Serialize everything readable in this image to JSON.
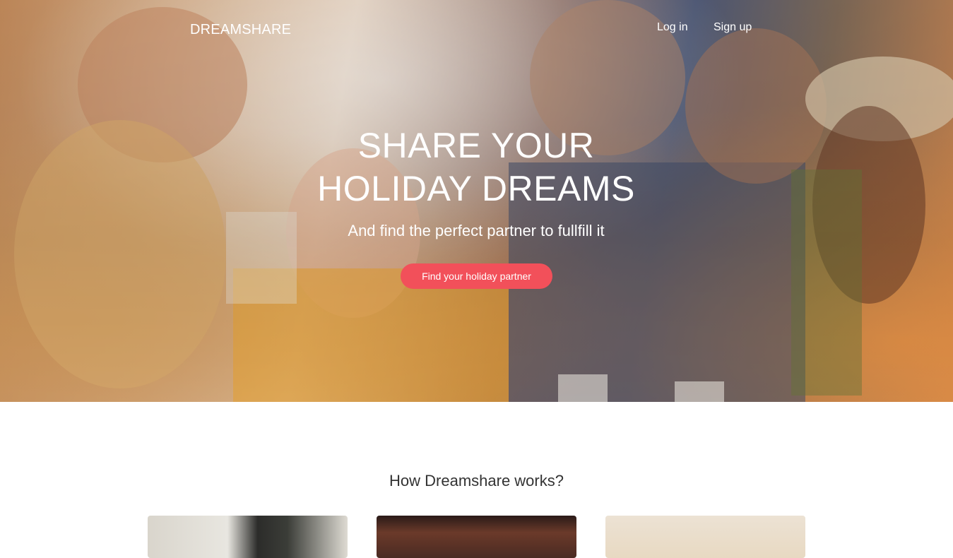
{
  "nav": {
    "logo": "DREAMSHARE",
    "login": "Log in",
    "signup": "Sign up"
  },
  "hero": {
    "title_line1": "SHARE YOUR",
    "title_line2": "HOLIDAY DREAMS",
    "subtitle": "And find the perfect partner to fullfill it",
    "cta": "Find your holiday partner"
  },
  "how_it_works": {
    "title": "How Dreamshare works?"
  },
  "colors": {
    "accent": "#f2505a",
    "text_dark": "#333333",
    "white": "#ffffff"
  }
}
